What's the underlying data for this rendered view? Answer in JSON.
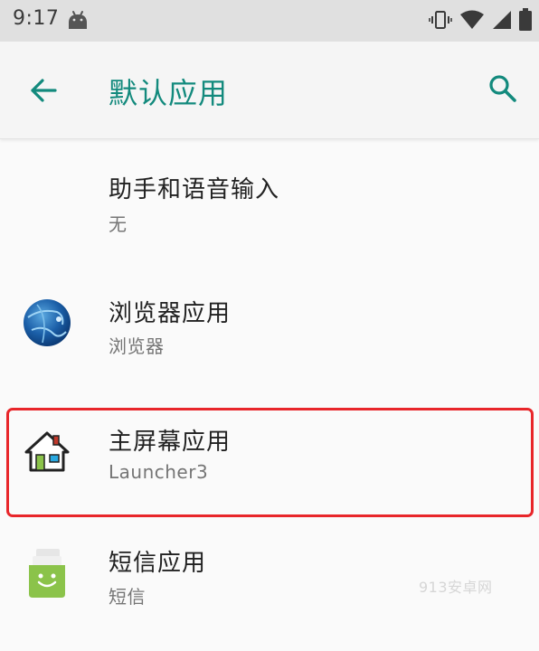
{
  "status_bar": {
    "time": "9:17",
    "icons": [
      "android-notification-icon",
      "vibrate-icon",
      "wifi-icon",
      "signal-icon",
      "battery-icon"
    ]
  },
  "app_bar": {
    "title": "默认应用",
    "back_icon": "arrow-back-icon",
    "search_icon": "search-icon",
    "accent_color": "#138a7d"
  },
  "items": [
    {
      "title": "助手和语音输入",
      "subtitle": "无",
      "icon": ""
    },
    {
      "title": "浏览器应用",
      "subtitle": "浏览器",
      "icon": "globe-icon"
    },
    {
      "title": "主屏幕应用",
      "subtitle": "Launcher3",
      "icon": "home-icon",
      "highlighted": true
    },
    {
      "title": "短信应用",
      "subtitle": "短信",
      "icon": "messaging-icon"
    }
  ],
  "highlight_color": "#e8262a",
  "watermark": "913安卓网"
}
